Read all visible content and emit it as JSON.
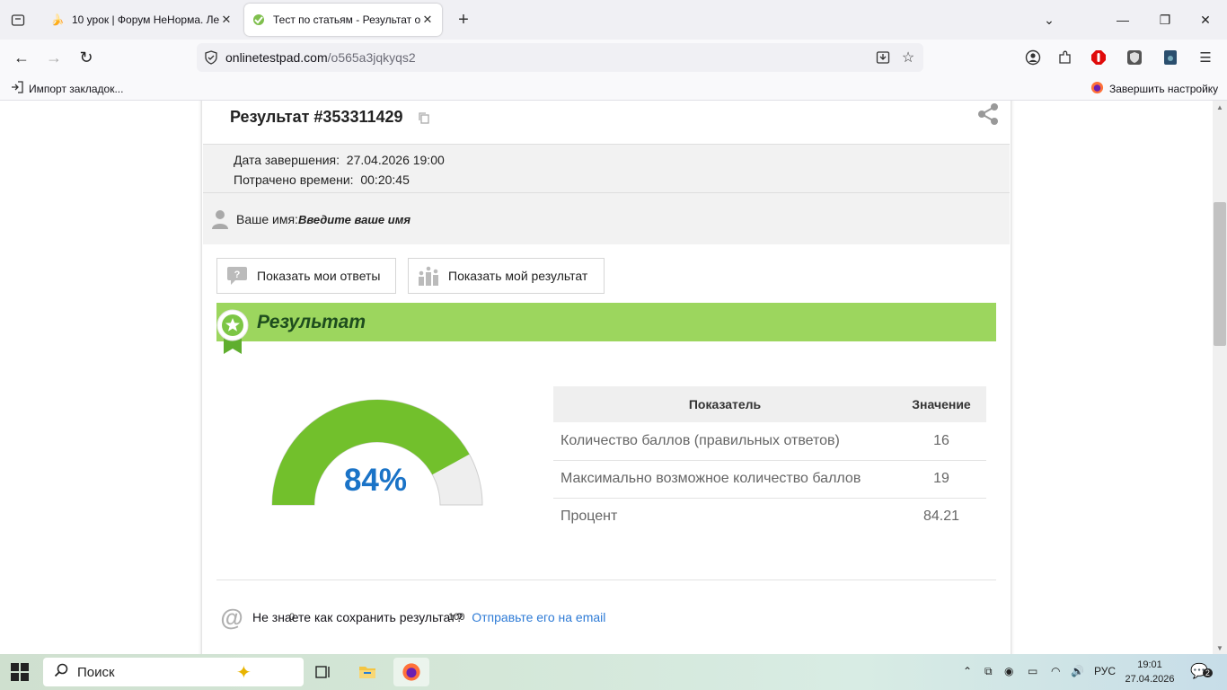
{
  "browser": {
    "tabs": [
      {
        "title": "10 урок | Форум НеНорма. Ле",
        "active": false
      },
      {
        "title": "Тест по статьям - Результат он",
        "active": true
      }
    ],
    "url_host": "onlinetestpad.com",
    "url_path": "/o565a3jqkyqs2",
    "bookmarks": {
      "import_label": "Импорт закладок...",
      "finish_setup_label": "Завершить настройку"
    }
  },
  "result": {
    "title": "Результат #353311429",
    "completed_label": "Дата завершения:",
    "completed_value": "27.04.2026 19:00",
    "time_label": "Потрачено времени:",
    "time_value": "00:20:45",
    "name_label": "Ваше имя:",
    "name_value": "Введите ваше имя",
    "show_answers_label": "Показать мои ответы",
    "show_result_label": "Показать мой результат",
    "section_title": "Результат",
    "gauge": {
      "percent": 84,
      "percent_label": "84%",
      "min_label": "0",
      "max_label": "100",
      "fill_color": "#72c02c",
      "empty_color": "#eeeeee"
    },
    "table": {
      "headers": [
        "Показатель",
        "Значение"
      ],
      "rows": [
        {
          "name": "Количество баллов (правильных ответов)",
          "value": "16"
        },
        {
          "name": "Максимально возможное количество баллов",
          "value": "19"
        },
        {
          "name": "Процент",
          "value": "84.21"
        }
      ]
    },
    "email_question": "Не знаете как сохранить результат?",
    "email_link": "Отправьте его на email"
  },
  "taskbar": {
    "search_placeholder": "Поиск",
    "language": "РУС",
    "time": "19:01",
    "date": "27.04.2026",
    "notification_count": "2"
  }
}
